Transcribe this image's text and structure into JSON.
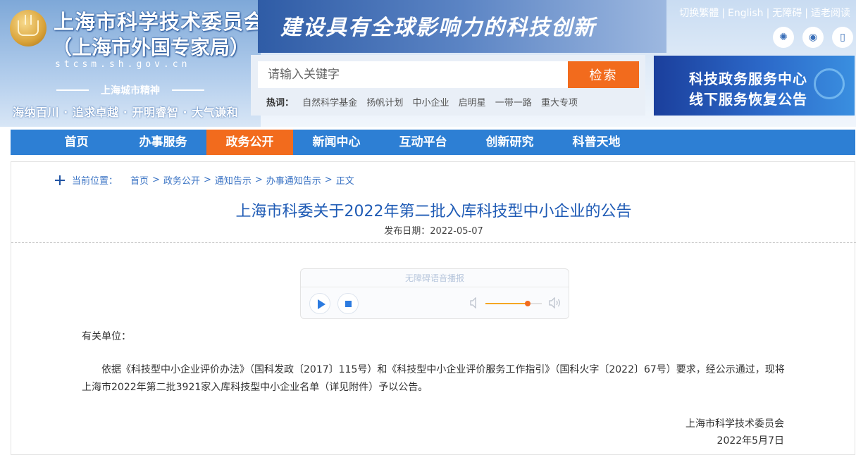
{
  "header": {
    "org_name": "上海市科学技术委员会",
    "org_sub": "（上海市外国专家局）",
    "domain": "stcsm.sh.gov.cn",
    "spirit_title": "上海城市精神",
    "spirit": "海纳百川 · 追求卓越 · 开明睿智 · 大气谦和",
    "banner_text": "建设具有全球影响力的科技创新"
  },
  "utility": {
    "traditional": "切换繁體",
    "english": "English",
    "accessibility": "无障碍",
    "elderly": "适老阅读",
    "separator": "|"
  },
  "socials": [
    {
      "icon": "weibo-icon",
      "glyph": "✺"
    },
    {
      "icon": "wechat-icon",
      "glyph": "◉"
    },
    {
      "icon": "mobile-icon",
      "glyph": "▯"
    }
  ],
  "search": {
    "placeholder": "请输入关键字",
    "button": "检索",
    "hot_label": "热词：",
    "hot_words": [
      "自然科学基金",
      "扬帆计划",
      "中小企业",
      "启明星",
      "一带一路",
      "重大专项"
    ]
  },
  "ad": {
    "line1": "科技政务服务中心",
    "line2": "线下服务恢复公告"
  },
  "nav": {
    "items": [
      "首页",
      "办事服务",
      "政务公开",
      "新闻中心",
      "互动平台",
      "创新研究",
      "科普天地"
    ],
    "active_index": 2
  },
  "breadcrumb": {
    "label": "当前位置：",
    "items": [
      "首页",
      "政务公开",
      "通知告示",
      "办事通知告示",
      "正文"
    ],
    "arrow": ">"
  },
  "article": {
    "title": "上海市科委关于2022年第二批入库科技型中小企业的公告",
    "date_label": "发布日期：",
    "date": "2022-05-07",
    "addressee": "有关单位：",
    "paragraph": "依据《科技型中小企业评价办法》（国科发政〔2017〕115号）和《科技型中小企业评价服务工作指引》（国科火字〔2022〕67号）要求，经公示通过，现将上海市2022年第二批3921家入库科技型中小企业名单（详见附件）予以公告。",
    "signature_org": "上海市科学技术委员会",
    "signature_date": "2022年5月7日"
  },
  "player": {
    "title": "无障碍语音播报",
    "volume": 0.75
  },
  "colors": {
    "nav_blue": "#2d7fd4",
    "accent_orange": "#f26b1d",
    "title_blue": "#1f5bb5",
    "link_blue": "#3a73c4"
  }
}
